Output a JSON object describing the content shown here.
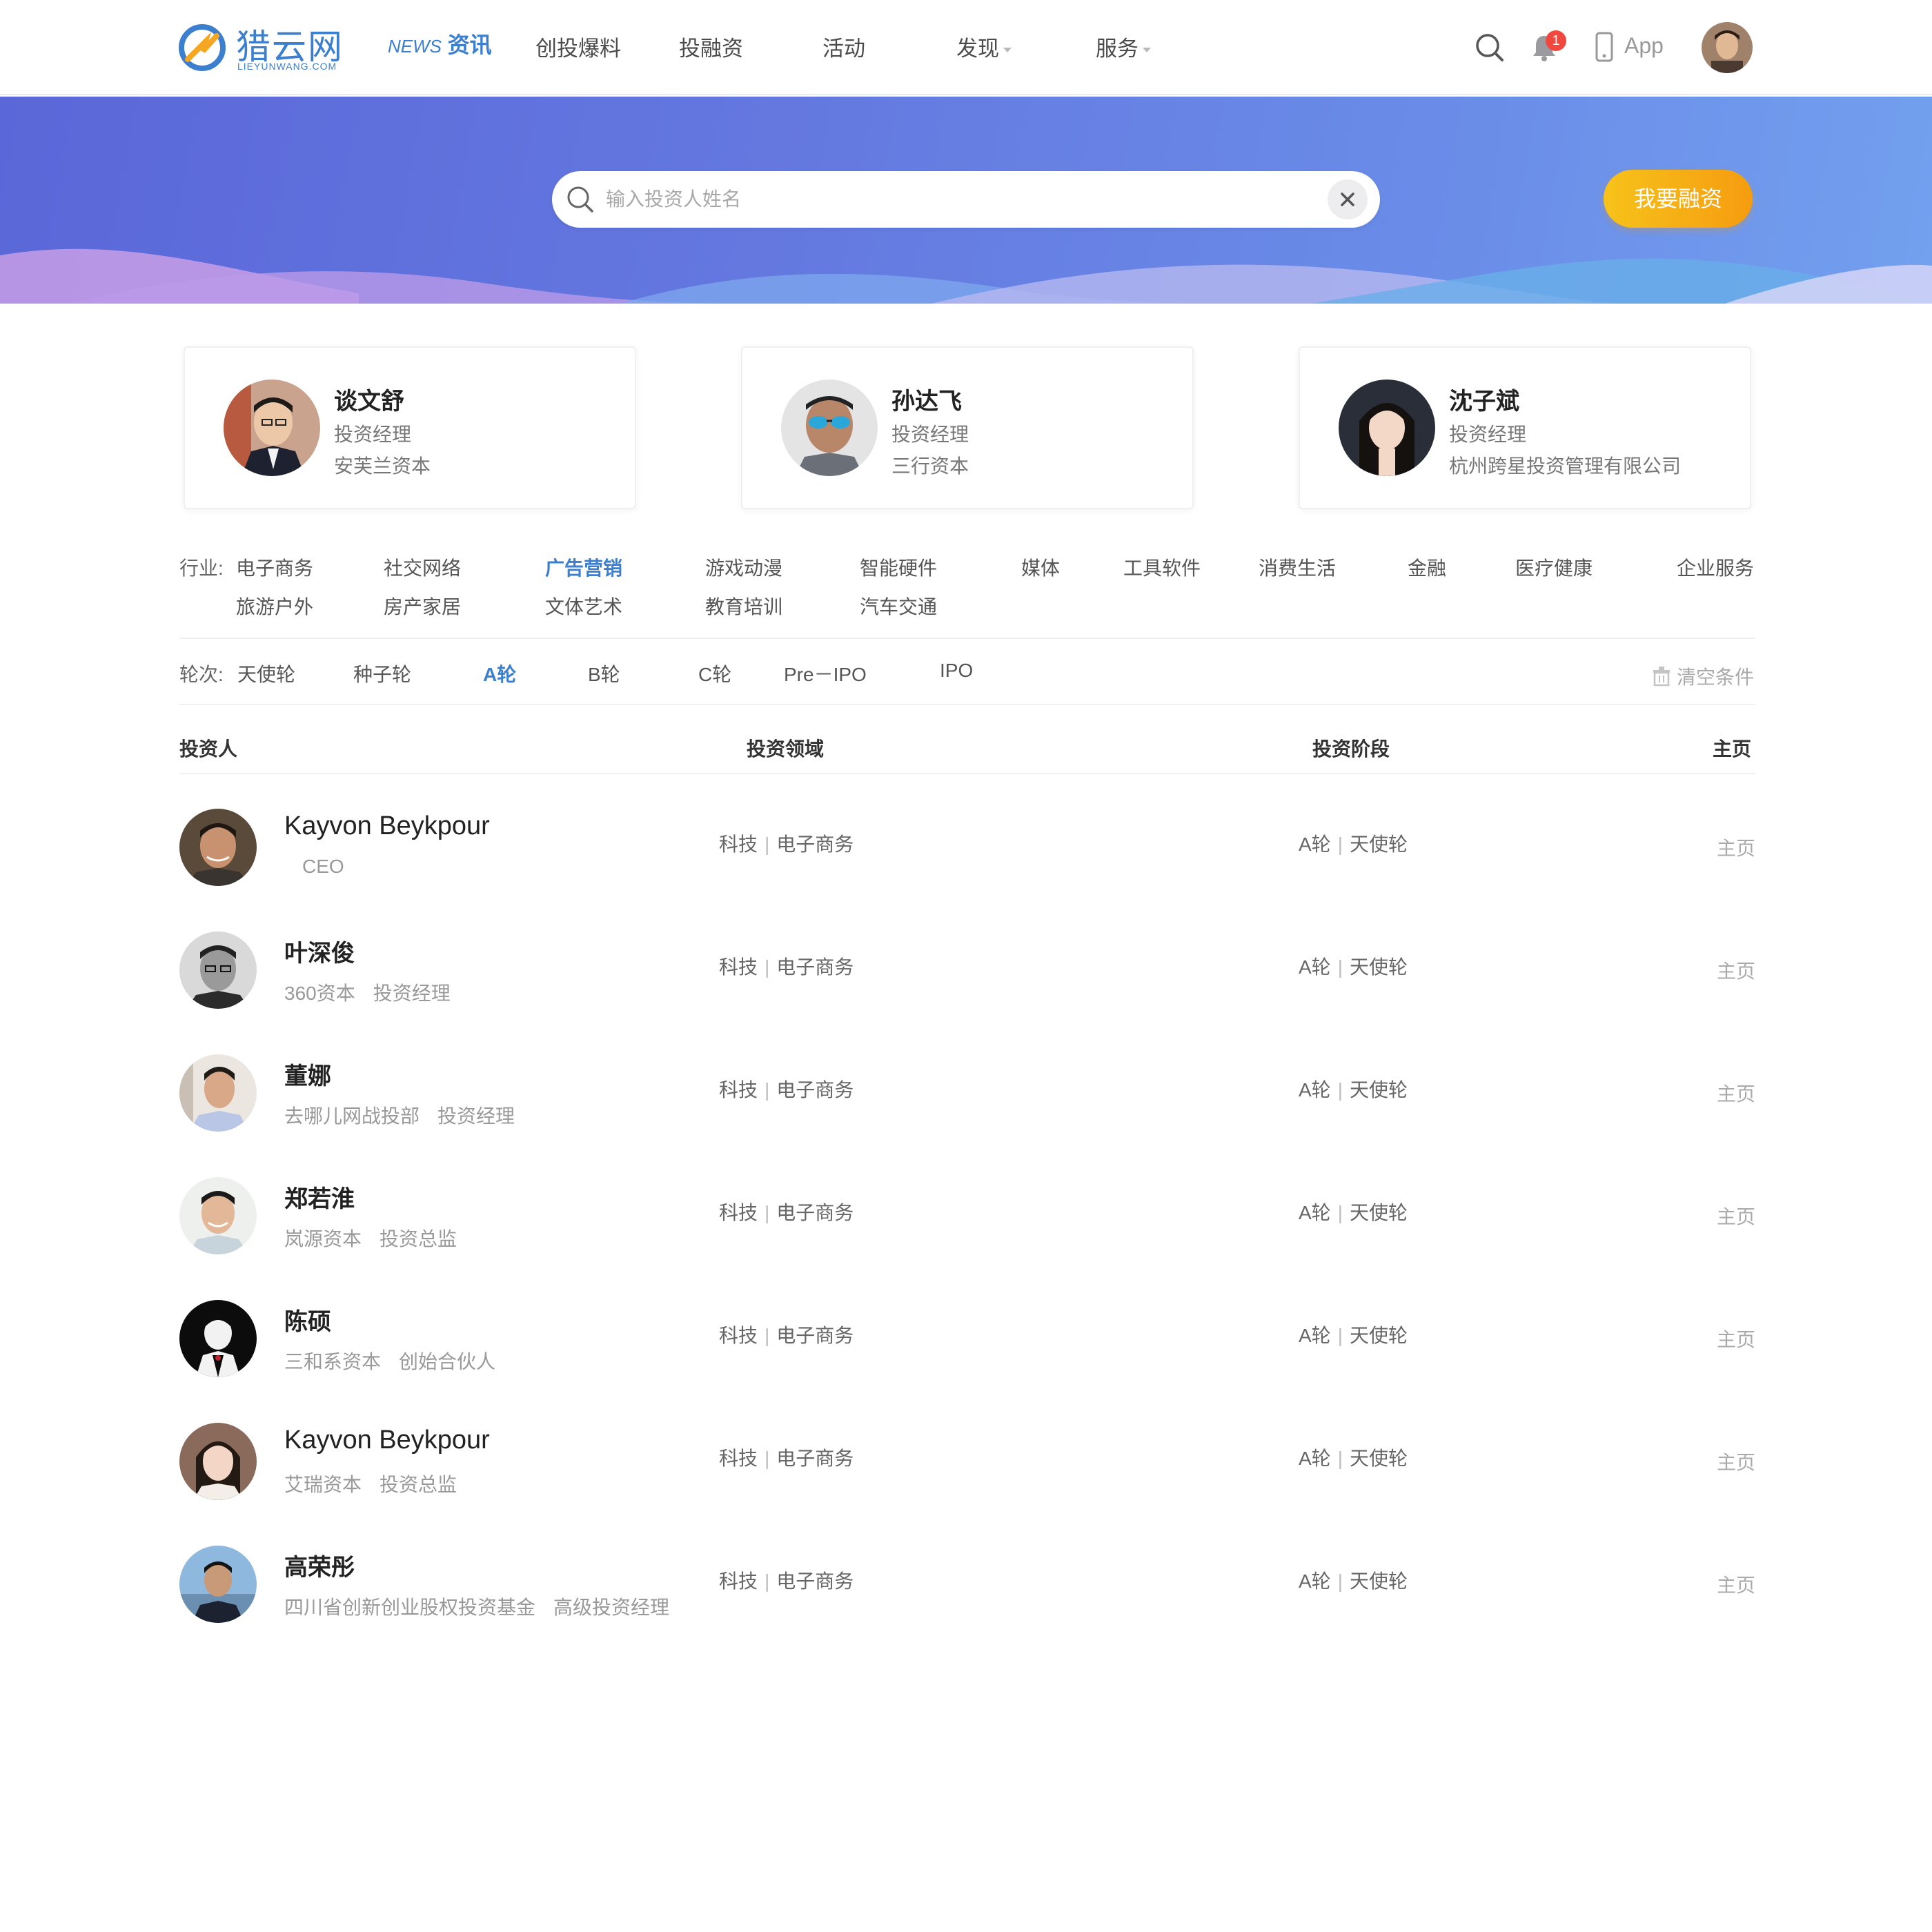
{
  "nav": {
    "logo_text": "猎云网",
    "logo_sub": "LIEYUNWANG.COM",
    "news_en": "NEWS",
    "news_cn": "资讯",
    "items": [
      "创投爆料",
      "投融资",
      "活动",
      "发现",
      "服务"
    ],
    "badge_count": "1",
    "app_label": "App"
  },
  "banner": {
    "search_placeholder": "输入投资人姓名",
    "fund_button": "我要融资"
  },
  "featured": [
    {
      "name": "谈文舒",
      "role": "投资经理",
      "org": "安芙兰资本"
    },
    {
      "name": "孙达飞",
      "role": "投资经理",
      "org": "三行资本"
    },
    {
      "name": "沈子斌",
      "role": "投资经理",
      "org": "杭州跨星投资管理有限公司"
    }
  ],
  "filters": {
    "industry_label": "行业:",
    "industries": [
      "电子商务",
      "社交网络",
      "广告营销",
      "游戏动漫",
      "智能硬件",
      "媒体",
      "工具软件",
      "消费生活",
      "金融",
      "医疗健康",
      "企业服务",
      "旅游户外",
      "房产家居",
      "文体艺术",
      "教育培训",
      "汽车交通"
    ],
    "active_industry": "广告营销",
    "round_label": "轮次:",
    "rounds": [
      "天使轮",
      "种子轮",
      "A轮",
      "B轮",
      "C轮",
      "Pre－IPO",
      "IPO"
    ],
    "active_round": "A轮",
    "clear_label": "清空条件"
  },
  "table": {
    "headers": [
      "投资人",
      "投资领域",
      "投资阶段",
      "主页"
    ],
    "rows": [
      {
        "name": "Kayvon Beykpour",
        "org": "",
        "title": "CEO",
        "field_a": "科技",
        "field_b": "电子商务",
        "stage_a": "A轮",
        "stage_b": "天使轮",
        "home": "主页"
      },
      {
        "name": "叶深俊",
        "org": "360资本",
        "title": "投资经理",
        "field_a": "科技",
        "field_b": "电子商务",
        "stage_a": "A轮",
        "stage_b": "天使轮",
        "home": "主页"
      },
      {
        "name": "董娜",
        "org": "去哪儿网战投部",
        "title": "投资经理",
        "field_a": "科技",
        "field_b": "电子商务",
        "stage_a": "A轮",
        "stage_b": "天使轮",
        "home": "主页"
      },
      {
        "name": "郑若淮",
        "org": "岚源资本",
        "title": "投资总监",
        "field_a": "科技",
        "field_b": "电子商务",
        "stage_a": "A轮",
        "stage_b": "天使轮",
        "home": "主页"
      },
      {
        "name": "陈硕",
        "org": "三和系资本",
        "title": "创始合伙人",
        "field_a": "科技",
        "field_b": "电子商务",
        "stage_a": "A轮",
        "stage_b": "天使轮",
        "home": "主页"
      },
      {
        "name": "Kayvon Beykpour",
        "org": "艾瑞资本",
        "title": "投资总监",
        "field_a": "科技",
        "field_b": "电子商务",
        "stage_a": "A轮",
        "stage_b": "天使轮",
        "home": "主页"
      },
      {
        "name": "高荣彤",
        "org": "四川省创新创业股权投资基金",
        "title": "高级投资经理",
        "field_a": "科技",
        "field_b": "电子商务",
        "stage_a": "A轮",
        "stage_b": "天使轮",
        "home": "主页"
      }
    ]
  },
  "colors": {
    "accent": "#3d7fcf",
    "banner_start": "#5a67d8",
    "banner_end": "#73a0ef",
    "fund_button": "#f7b016",
    "badge": "#f0473f"
  }
}
